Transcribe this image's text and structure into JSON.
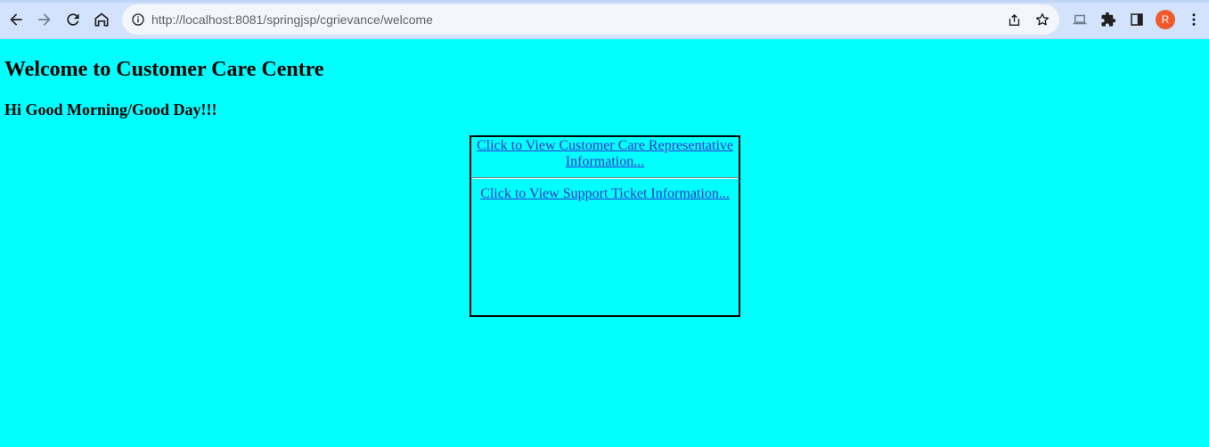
{
  "browser": {
    "url": "http://localhost:8081/springjsp/cgrievance/welcome",
    "profile_initial": "R",
    "icons": {
      "back": "back-arrow-icon",
      "forward": "forward-arrow-icon",
      "reload": "reload-icon",
      "home": "home-icon",
      "site_info": "info-icon",
      "share": "share-icon",
      "bookmark": "star-icon",
      "cast": "laptop-icon",
      "extensions": "puzzle-icon",
      "side_panel": "side-panel-icon",
      "menu": "kebab-menu-icon"
    },
    "colors": {
      "toolbar": "#d3e3fd",
      "omnibox": "#f3f6fc",
      "avatar": "#f1582c"
    }
  },
  "page": {
    "background": "#00ffff",
    "title": "Welcome to Customer Care Centre",
    "greeting": "Hi Good Morning/Good Day!!!",
    "links": [
      "Click to View Customer Care Representative Information...",
      "Click to View Support Ticket Information..."
    ]
  }
}
